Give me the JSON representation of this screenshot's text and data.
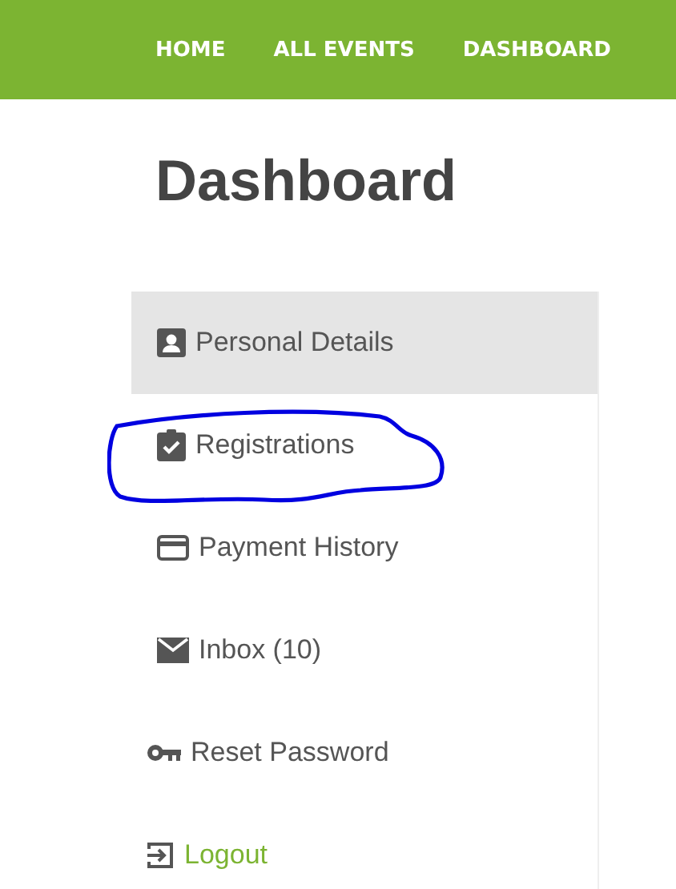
{
  "nav": {
    "items": [
      {
        "label": "HOME"
      },
      {
        "label": "ALL EVENTS"
      },
      {
        "label": "DASHBOARD"
      }
    ]
  },
  "page_title": "Dashboard",
  "sidebar": {
    "items": [
      {
        "label": "Personal Details",
        "kind": "person",
        "selected": true,
        "circled": false,
        "link": false
      },
      {
        "label": "Registrations",
        "kind": "clipboard",
        "selected": false,
        "circled": true,
        "link": false
      },
      {
        "label": "Payment History",
        "kind": "card",
        "selected": false,
        "circled": false,
        "link": false
      },
      {
        "label": "Inbox (10)",
        "kind": "mail",
        "selected": false,
        "circled": false,
        "link": false
      },
      {
        "label": "Reset Password",
        "kind": "key",
        "selected": false,
        "circled": false,
        "link": false
      },
      {
        "label": "Logout",
        "kind": "logout",
        "selected": false,
        "circled": false,
        "link": true
      }
    ]
  }
}
